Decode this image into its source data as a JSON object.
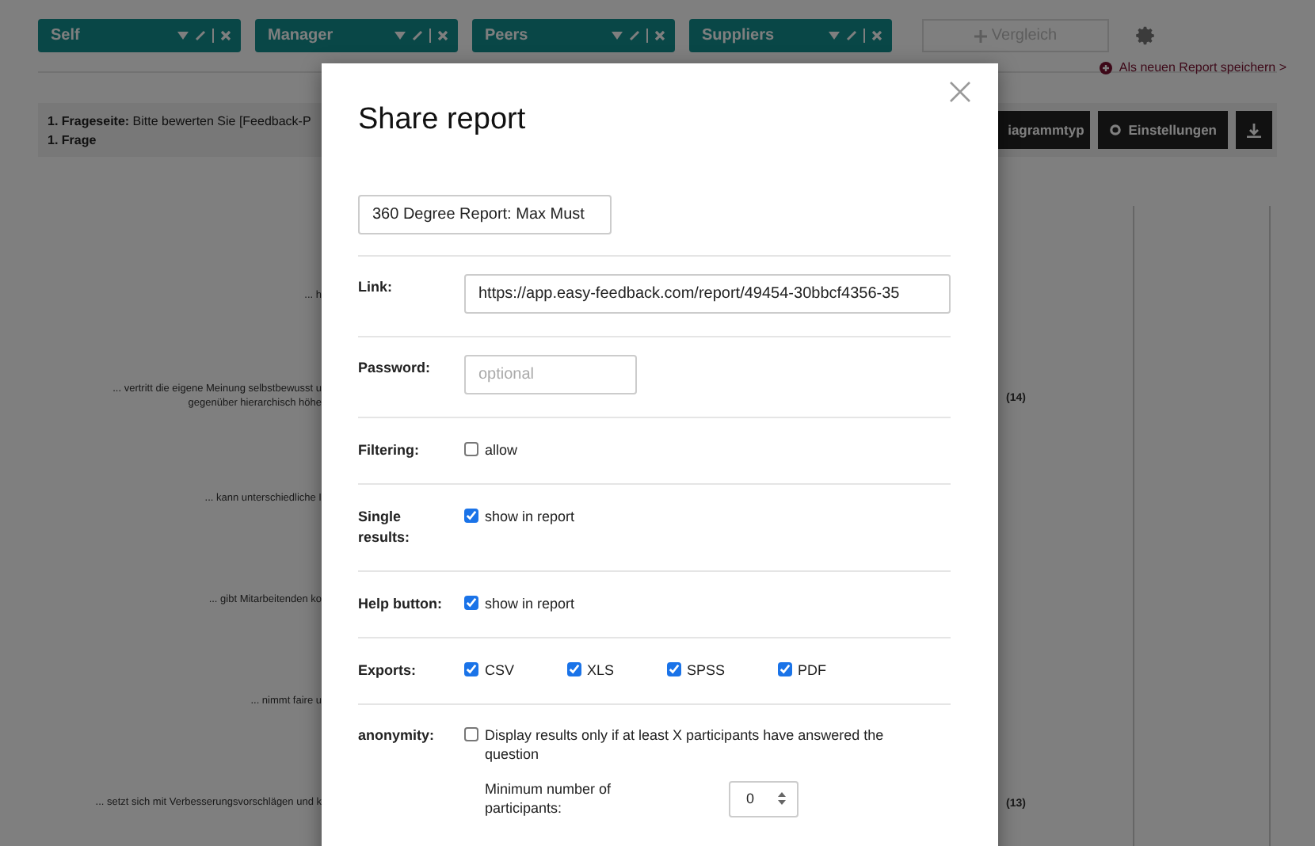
{
  "filter_tabs": [
    {
      "label": "Self"
    },
    {
      "label": "Manager"
    },
    {
      "label": "Peers"
    },
    {
      "label": "Suppliers"
    }
  ],
  "compare_button": {
    "label": "Vergleich",
    "disabled": true
  },
  "save_link": "Als neuen Report speichern >",
  "question_header": {
    "page": "**1. Frageseite:** Bitte bewerten Sie [Feedback-P",
    "question": "1. Frage"
  },
  "toolbar_buttons": [
    {
      "kind": "text",
      "label": "iagrammtyp"
    },
    {
      "kind": "settings",
      "label": "Einstellungen"
    },
    {
      "kind": "download"
    }
  ],
  "chart_rows": [
    {
      "lines": [
        "... h"
      ]
    },
    {
      "lines": [
        "... vertritt die eigene Meinung selbstbewusst u",
        "gegenüber hierarchisch höhe"
      ],
      "count": "(14)"
    },
    {
      "lines": [
        "... kann unterschiedliche I"
      ]
    },
    {
      "lines": [
        "... gibt Mitarbeitenden ko"
      ]
    },
    {
      "lines": [
        "... nimmt faire u"
      ]
    },
    {
      "lines": [
        "... setzt sich mit Verbesserungsvorschlägen und k"
      ],
      "count": "(13)"
    }
  ],
  "modal": {
    "title": "Share report",
    "name_value": "360 Degree Report: Max Must",
    "rows": [
      {
        "kind": "text",
        "label": "Link:",
        "value": "https://app.easy-feedback.com/report/49454-30bbcf4356-35"
      },
      {
        "kind": "password",
        "label": "Password:",
        "placeholder": "optional"
      },
      {
        "kind": "checkboxes",
        "label": "Filtering:",
        "options": [
          {
            "label": "allow",
            "checked": false
          }
        ]
      },
      {
        "kind": "checkboxes",
        "label": "Single results:",
        "options": [
          {
            "label": "show in report",
            "checked": true
          }
        ]
      },
      {
        "kind": "checkboxes",
        "label": "Help button:",
        "options": [
          {
            "label": "show in report",
            "checked": true
          }
        ]
      },
      {
        "kind": "checkboxes",
        "label": "Exports:",
        "options": [
          {
            "label": "CSV",
            "checked": true
          },
          {
            "label": "XLS",
            "checked": true
          },
          {
            "label": "SPSS",
            "checked": true
          },
          {
            "label": "PDF",
            "checked": true
          }
        ]
      },
      {
        "kind": "anonymity",
        "label": "anonymity:",
        "option": {
          "label": "Display results only if at least X participants have answered the question",
          "checked": false
        },
        "min_label": "Minimum number of participants:",
        "min_value": "0"
      }
    ]
  }
}
